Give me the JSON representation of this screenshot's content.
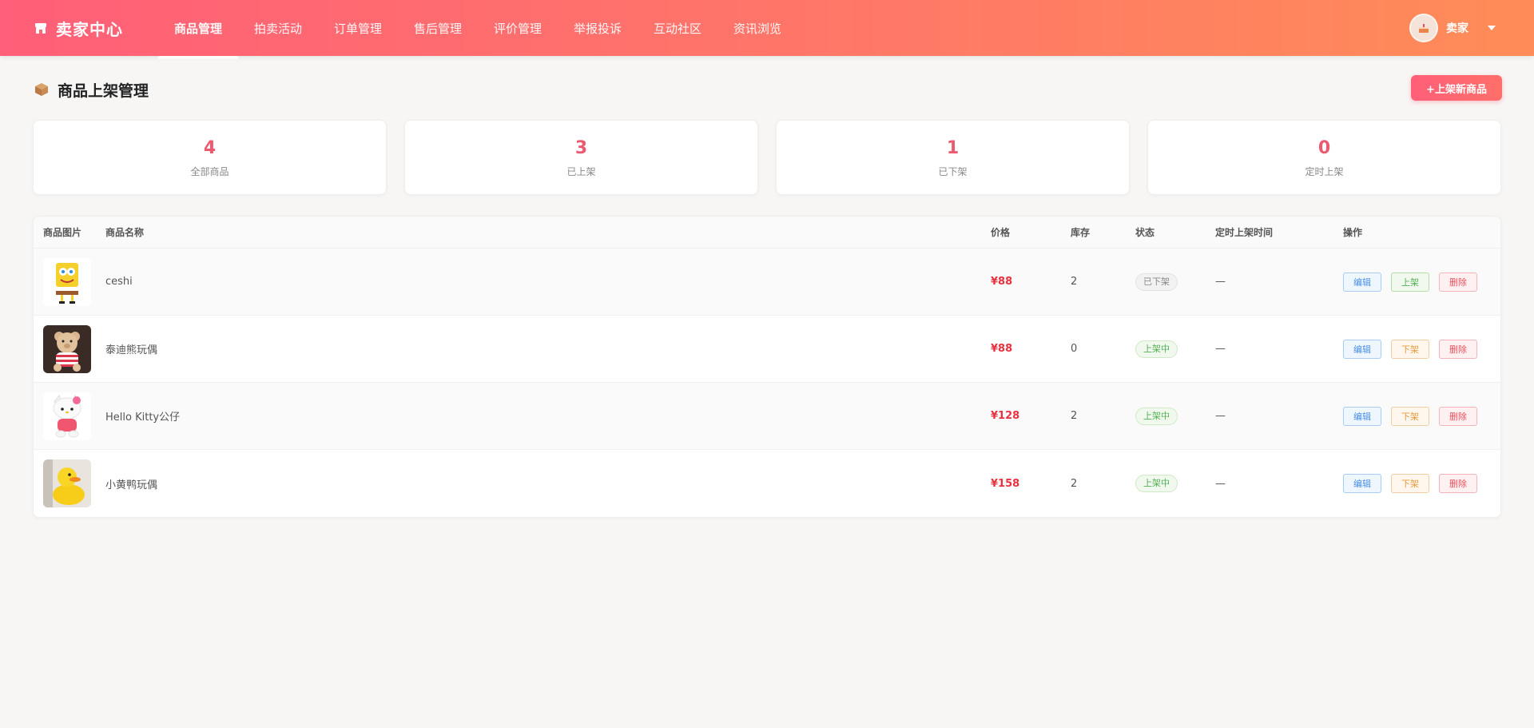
{
  "header": {
    "brand": "卖家中心",
    "nav": [
      {
        "label": "商品管理",
        "active": true
      },
      {
        "label": "拍卖活动",
        "active": false
      },
      {
        "label": "订单管理",
        "active": false
      },
      {
        "label": "售后管理",
        "active": false
      },
      {
        "label": "评价管理",
        "active": false
      },
      {
        "label": "举报投诉",
        "active": false
      },
      {
        "label": "互动社区",
        "active": false
      },
      {
        "label": "资讯浏览",
        "active": false
      }
    ],
    "user": {
      "name": "卖家"
    }
  },
  "page": {
    "title": "商品上架管理",
    "add_button": "+上架新商品"
  },
  "stats": [
    {
      "value": "4",
      "label": "全部商品"
    },
    {
      "value": "3",
      "label": "已上架"
    },
    {
      "value": "1",
      "label": "已下架"
    },
    {
      "value": "0",
      "label": "定时上架"
    }
  ],
  "table": {
    "columns": [
      "商品图片",
      "商品名称",
      "价格",
      "库存",
      "状态",
      "定时上架时间",
      "操作"
    ],
    "rows": [
      {
        "name": "ceshi",
        "price": "¥88",
        "stock": "2",
        "status": "已下架",
        "status_kind": "off",
        "scheduled": "—",
        "ops": [
          {
            "label": "编辑",
            "kind": "edit"
          },
          {
            "label": "上架",
            "kind": "up"
          },
          {
            "label": "删除",
            "kind": "del"
          }
        ]
      },
      {
        "name": "泰迪熊玩偶",
        "price": "¥88",
        "stock": "0",
        "status": "上架中",
        "status_kind": "on",
        "scheduled": "—",
        "ops": [
          {
            "label": "编辑",
            "kind": "edit"
          },
          {
            "label": "下架",
            "kind": "down"
          },
          {
            "label": "删除",
            "kind": "del"
          }
        ]
      },
      {
        "name": "Hello Kitty公仔",
        "price": "¥128",
        "stock": "2",
        "status": "上架中",
        "status_kind": "on",
        "scheduled": "—",
        "ops": [
          {
            "label": "编辑",
            "kind": "edit"
          },
          {
            "label": "下架",
            "kind": "down"
          },
          {
            "label": "删除",
            "kind": "del"
          }
        ]
      },
      {
        "name": "小黄鸭玩偶",
        "price": "¥158",
        "stock": "2",
        "status": "上架中",
        "status_kind": "on",
        "scheduled": "—",
        "ops": [
          {
            "label": "编辑",
            "kind": "edit"
          },
          {
            "label": "下架",
            "kind": "down"
          },
          {
            "label": "删除",
            "kind": "del"
          }
        ]
      }
    ]
  },
  "icons": {
    "brand": "store-icon",
    "title": "package-box-icon",
    "caret": "chevron-down-icon"
  },
  "colors": {
    "accent": "#ff5f78",
    "price": "#e8323f",
    "stat": "#ec5a70"
  }
}
